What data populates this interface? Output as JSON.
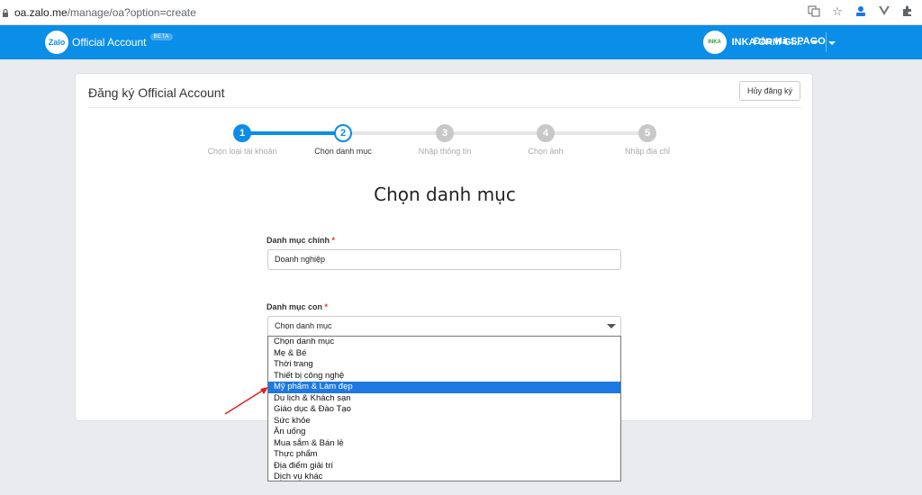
{
  "browser": {
    "url_host": "oa.zalo.me",
    "url_path": "/manage/oa?option=create"
  },
  "header": {
    "logo_text": "Zalo",
    "app_name": "Official Account",
    "beta_badge": "BETA",
    "org_logo_text": "INKA",
    "org_name": "INKA CRM GI...",
    "user_name": "Đào Hà SPAGO",
    "brand_color": "#0b8ee8"
  },
  "card": {
    "title": "Đăng ký Official Account",
    "cancel_label": "Hủy đăng ký"
  },
  "steps": [
    {
      "number": "1",
      "label": "Chọn loại tài khoản",
      "state": "done"
    },
    {
      "number": "2",
      "label": "Chọn danh mục",
      "state": "current"
    },
    {
      "number": "3",
      "label": "Nhập thông tin",
      "state": "todo"
    },
    {
      "number": "4",
      "label": "Chọn ảnh",
      "state": "todo"
    },
    {
      "number": "5",
      "label": "Nhập địa chỉ",
      "state": "todo"
    }
  ],
  "heading": "Chọn danh mục",
  "main_category": {
    "label": "Danh mục chính",
    "required_mark": "*",
    "value": "Doanh nghiệp"
  },
  "sub_category": {
    "label": "Danh mục con",
    "required_mark": "*",
    "selected": "Chọn danh mục",
    "options": [
      "Chọn danh mục",
      "Mẹ & Bé",
      "Thời trang",
      "Thiết bị công nghệ",
      "Mỹ phẩm & Làm đẹp",
      "Du lịch & Khách sạn",
      "Giáo dục & Đào Tạo",
      "Sức khỏe",
      "Ăn uống",
      "Mua sắm & Bán lẻ",
      "Thực phẩm",
      "Địa điểm giải trí",
      "Dịch vụ khác"
    ],
    "highlighted": "Mỹ phẩm & Làm đẹp"
  }
}
